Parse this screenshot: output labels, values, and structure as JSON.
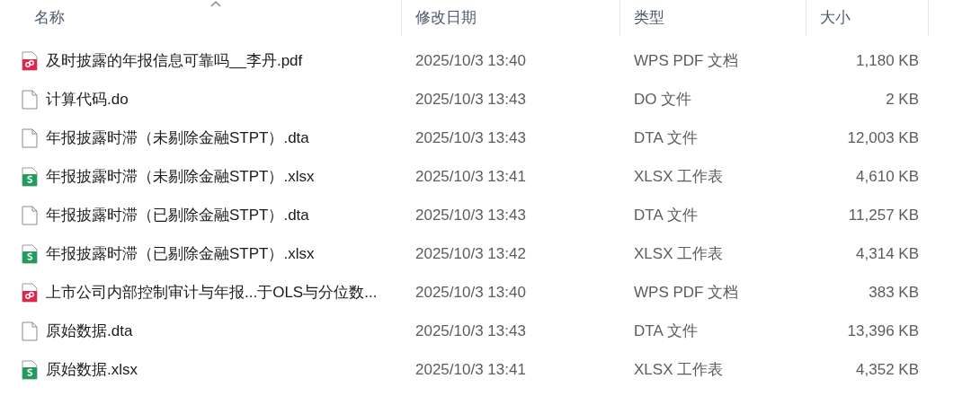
{
  "columns": [
    {
      "label": "名称",
      "sorted": true
    },
    {
      "label": "修改日期",
      "sorted": false
    },
    {
      "label": "类型",
      "sorted": false
    },
    {
      "label": "大小",
      "sorted": false
    }
  ],
  "files": [
    {
      "kind": "pdf",
      "name": "及时披露的年报信息可靠吗__李丹.pdf",
      "modified": "2025/10/3 13:40",
      "type": "WPS PDF 文档",
      "size": "1,180 KB"
    },
    {
      "kind": "blank",
      "name": "计算代码.do",
      "modified": "2025/10/3 13:43",
      "type": "DO 文件",
      "size": "2 KB"
    },
    {
      "kind": "blank",
      "name": "年报披露时滞（未剔除金融STPT）.dta",
      "modified": "2025/10/3 13:43",
      "type": "DTA 文件",
      "size": "12,003 KB"
    },
    {
      "kind": "xlsx",
      "name": "年报披露时滞（未剔除金融STPT）.xlsx",
      "modified": "2025/10/3 13:41",
      "type": "XLSX 工作表",
      "size": "4,610 KB"
    },
    {
      "kind": "blank",
      "name": "年报披露时滞（已剔除金融STPT）.dta",
      "modified": "2025/10/3 13:43",
      "type": "DTA 文件",
      "size": "11,257 KB"
    },
    {
      "kind": "xlsx",
      "name": "年报披露时滞（已剔除金融STPT）.xlsx",
      "modified": "2025/10/3 13:42",
      "type": "XLSX 工作表",
      "size": "4,314 KB"
    },
    {
      "kind": "pdf",
      "name": "上市公司内部控制审计与年报...于OLS与分位数...",
      "modified": "2025/10/3 13:40",
      "type": "WPS PDF 文档",
      "size": "383 KB"
    },
    {
      "kind": "blank",
      "name": "原始数据.dta",
      "modified": "2025/10/3 13:43",
      "type": "DTA 文件",
      "size": "13,396 KB"
    },
    {
      "kind": "xlsx",
      "name": "原始数据.xlsx",
      "modified": "2025/10/3 13:41",
      "type": "XLSX 工作表",
      "size": "4,352 KB"
    }
  ]
}
